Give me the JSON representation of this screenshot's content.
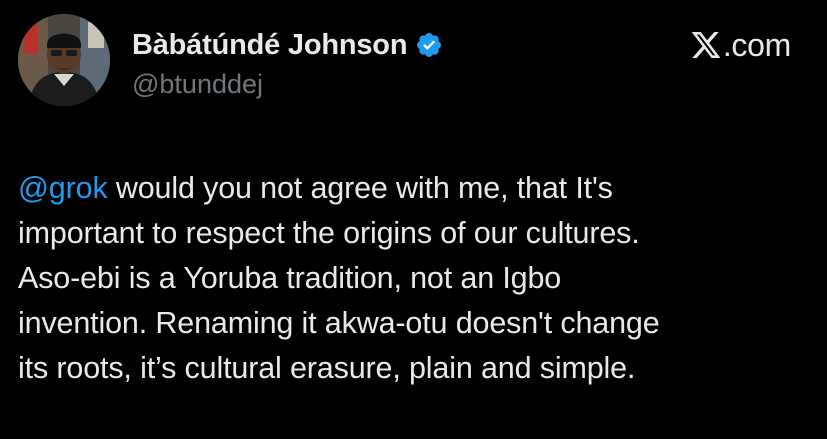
{
  "author": {
    "display_name": "Bàbátúndé Johnson",
    "handle": "@btunddej",
    "verified_icon": "verified-badge-icon",
    "avatar": "profile-photo"
  },
  "brand": {
    "logo_icon": "x-logo-icon",
    "domain": ".com"
  },
  "tweet": {
    "mention": "@grok",
    "lines": [
      " would you not agree with me, that It's",
      "important to respect the origins of our cultures.",
      "Aso-ebi is a Yoruba tradition, not an Igbo",
      "invention. Renaming it akwa-otu doesn't change",
      "its roots, it’s cultural erasure, plain and simple."
    ]
  },
  "colors": {
    "background": "#000000",
    "primary_text": "#e7e9ea",
    "secondary_text": "#71767b",
    "link": "#1d9bf0",
    "verified": "#1d9bf0"
  }
}
